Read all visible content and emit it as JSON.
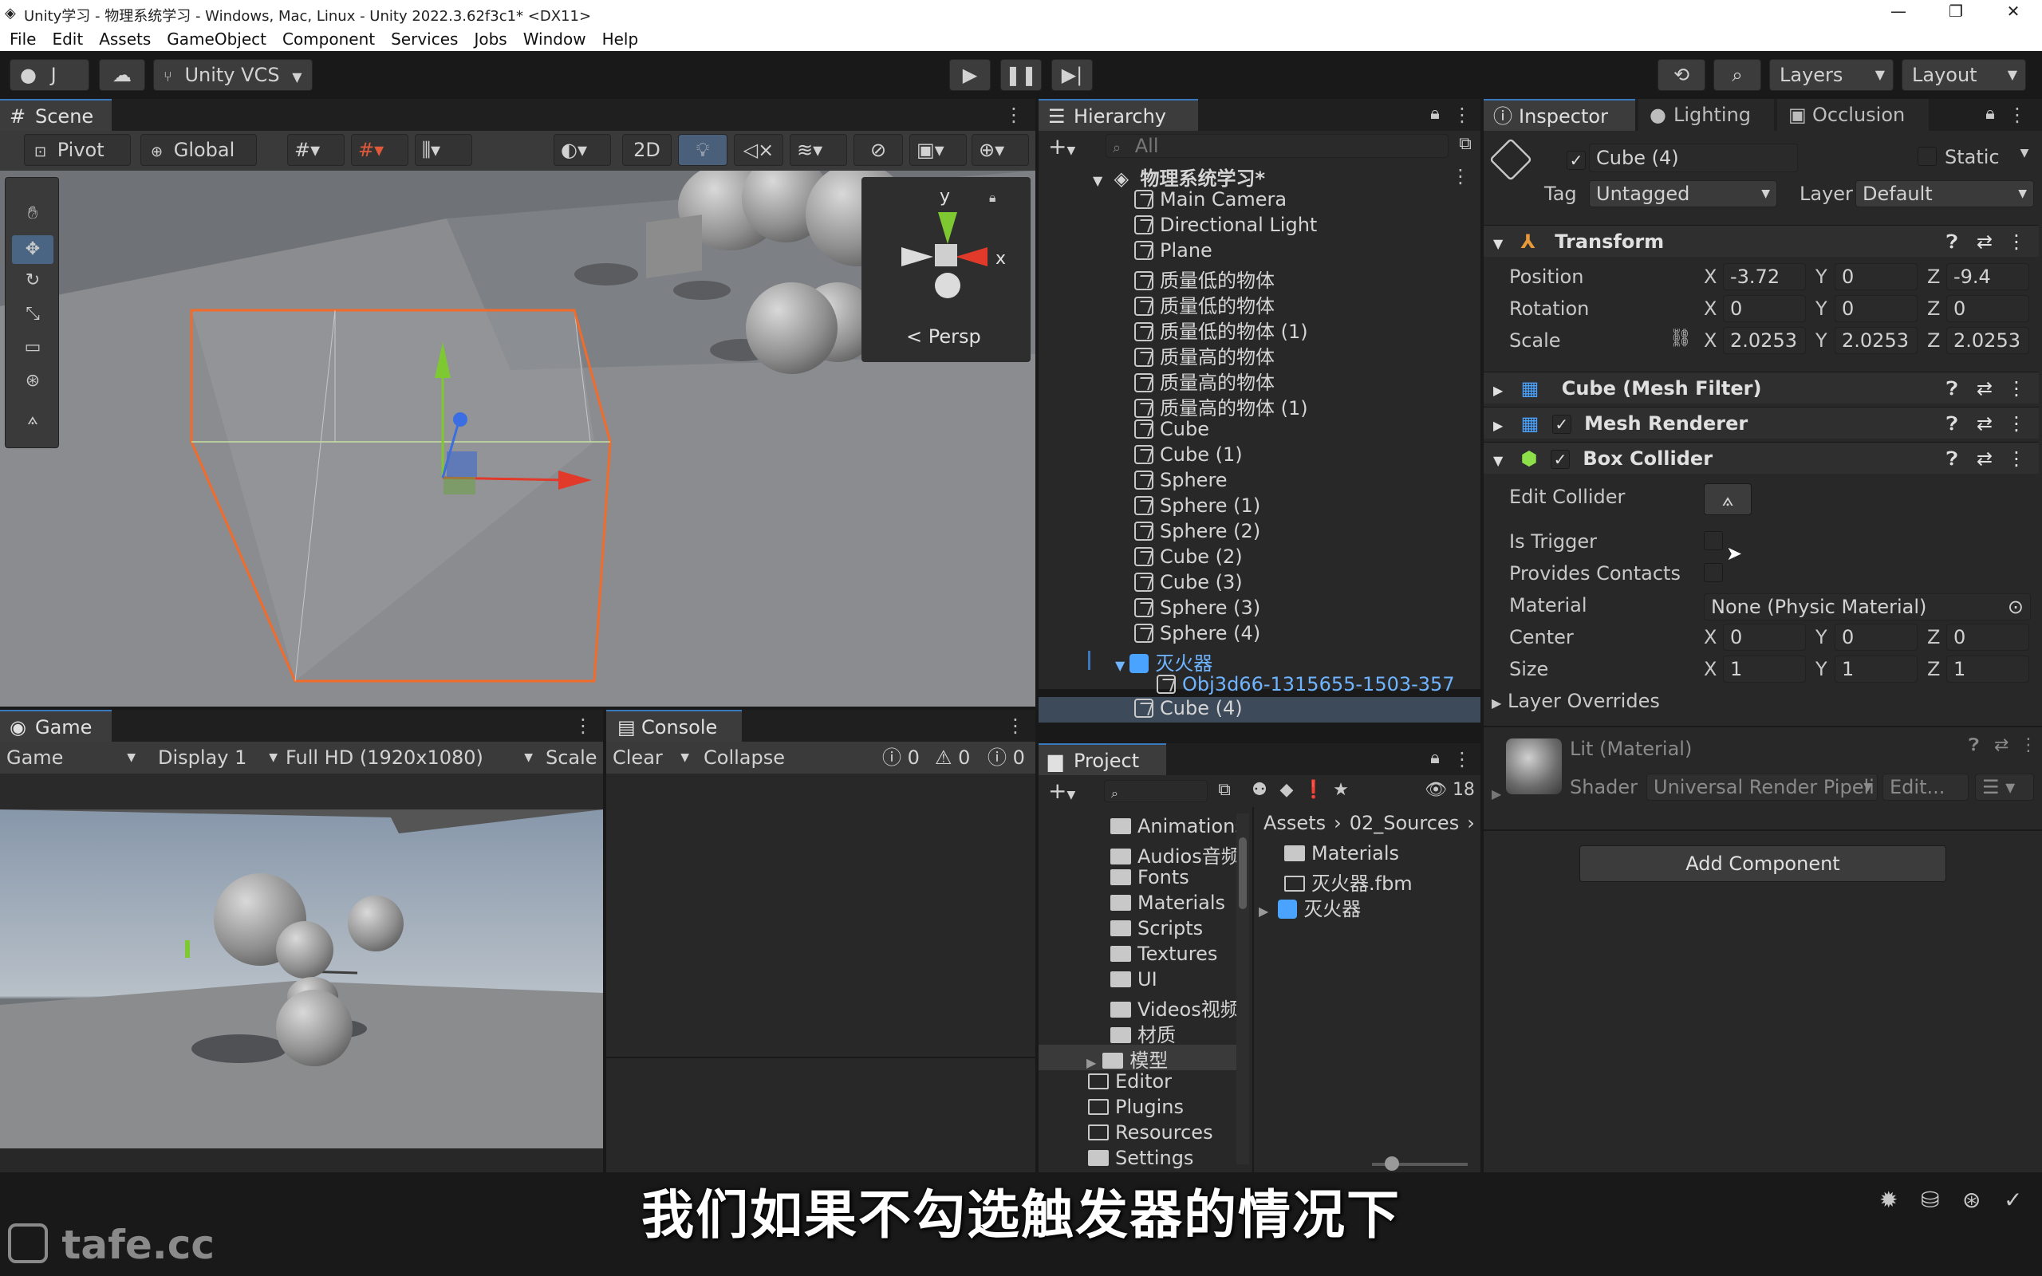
{
  "window": {
    "title": "Unity学习 - 物理系统学习 - Windows, Mac, Linux - Unity 2022.3.62f3c1* <DX11>",
    "controls": [
      "—",
      "❐",
      "✕"
    ]
  },
  "menu": [
    "File",
    "Edit",
    "Assets",
    "GameObject",
    "Component",
    "Services",
    "Jobs",
    "Window",
    "Help"
  ],
  "toolbar": {
    "account": "J",
    "vcs": "Unity VCS",
    "layers": "Layers",
    "layout": "Layout"
  },
  "scene": {
    "tab": "Scene",
    "pivot": "Pivot",
    "global": "Global",
    "mode2d": "2D",
    "persp": "< Persp",
    "gizmo_y": "y",
    "gizmo_x": "x"
  },
  "game": {
    "tab": "Game",
    "mode": "Game",
    "display": "Display 1",
    "resolution": "Full HD (1920x1080)",
    "scale": "Scale"
  },
  "console": {
    "tab": "Console",
    "clear": "Clear",
    "collapse": "Collapse",
    "logs": "0",
    "warnings": "0",
    "errors": "0"
  },
  "hierarchy": {
    "tab": "Hierarchy",
    "search_placeholder": "All",
    "scene_name": "物理系统学习*",
    "items": [
      {
        "label": "Main Camera"
      },
      {
        "label": "Directional Light"
      },
      {
        "label": "Plane"
      },
      {
        "label": "质量低的物体"
      },
      {
        "label": "质量低的物体"
      },
      {
        "label": "质量低的物体 (1)"
      },
      {
        "label": "质量高的物体"
      },
      {
        "label": "质量高的物体"
      },
      {
        "label": "质量高的物体 (1)"
      },
      {
        "label": "Cube"
      },
      {
        "label": "Cube (1)"
      },
      {
        "label": "Sphere"
      },
      {
        "label": "Sphere (1)"
      },
      {
        "label": "Sphere (2)"
      },
      {
        "label": "Cube (2)"
      },
      {
        "label": "Cube (3)"
      },
      {
        "label": "Sphere (3)"
      },
      {
        "label": "Sphere (4)"
      }
    ],
    "prefab": "灭火器",
    "prefab_child": "Obj3d66-1315655-1503-357",
    "selected": "Cube (4)"
  },
  "project": {
    "tab": "Project",
    "hidden_count": "18",
    "tree": [
      "Animations",
      "Audios音频",
      "Fonts",
      "Materials",
      "Scripts",
      "Textures",
      "UI",
      "Videos视频",
      "材质",
      "模型"
    ],
    "root_folders": [
      "Editor",
      "Plugins",
      "Resources",
      "Settings"
    ],
    "breadcrumb": [
      "Assets",
      "02_Sources"
    ],
    "assets": [
      "Materials",
      "灭火器.fbm",
      "灭火器"
    ]
  },
  "inspector": {
    "tabs": [
      "Inspector",
      "Lighting",
      "Occlusion"
    ],
    "object_name": "Cube (4)",
    "static_label": "Static",
    "tag_label": "Tag",
    "tag_value": "Untagged",
    "layer_label": "Layer",
    "layer_value": "Default",
    "transform": {
      "title": "Transform",
      "position_label": "Position",
      "rotation_label": "Rotation",
      "scale_label": "Scale",
      "position": {
        "x": "-3.72",
        "y": "0",
        "z": "-9.4"
      },
      "rotation": {
        "x": "0",
        "y": "0",
        "z": "0"
      },
      "scale": {
        "x": "2.0253",
        "y": "2.0253",
        "z": "2.0253"
      }
    },
    "mesh_filter": "Cube (Mesh Filter)",
    "mesh_renderer": "Mesh Renderer",
    "box_collider": {
      "title": "Box Collider",
      "edit_collider": "Edit Collider",
      "is_trigger": "Is Trigger",
      "provides_contacts": "Provides Contacts",
      "material_label": "Material",
      "material_value": "None (Physic Material)",
      "center_label": "Center",
      "center": {
        "x": "0",
        "y": "0",
        "z": "0"
      },
      "size_label": "Size",
      "size": {
        "x": "1",
        "y": "1",
        "z": "1"
      },
      "layer_overrides": "Layer Overrides"
    },
    "material": {
      "name": "Lit (Material)",
      "shader_label": "Shader",
      "shader_value": "Universal Render Pipeli",
      "edit": "Edit..."
    },
    "add_component": "Add Component",
    "axis_x": "X",
    "axis_y": "Y",
    "axis_z": "Z"
  },
  "subtitle": "我们如果不勾选触发器的情况下",
  "watermark": "tafe.cc",
  "colors": {
    "accent": "#3a79bb",
    "selection": "#2c5d87",
    "prefab": "#4aa3ff",
    "gizmo_x": "#e23a2a",
    "gizmo_y": "#7ec832",
    "gizmo_z": "#3a6ee2",
    "selection_outline": "#f26b2a"
  }
}
